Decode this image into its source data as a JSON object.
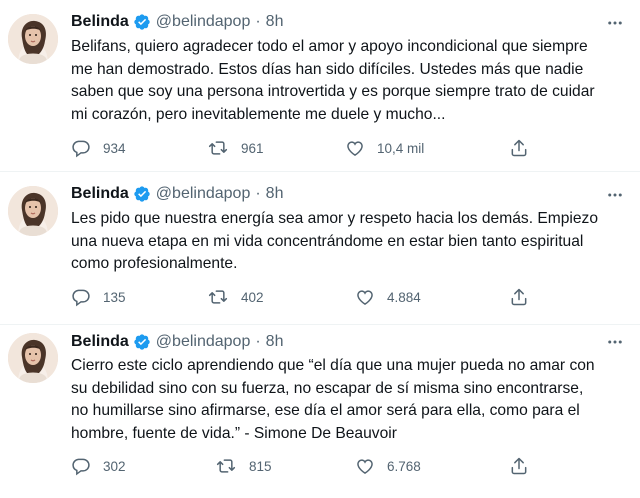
{
  "tweets": [
    {
      "author": "Belinda",
      "handle": "@belindapop",
      "separator": "·",
      "time": "8h",
      "text": "Belifans, quiero agradecer todo el amor y apoyo incondicional que siempre\nme han demostrado. Estos días han sido difíciles. Ustedes más que nadie\nsaben que soy una persona introvertida y es porque siempre trato de cuidar\nmi corazón, pero inevitablemente me duele y mucho...",
      "replies": "934",
      "retweets": "961",
      "likes": "10,4 mil"
    },
    {
      "author": "Belinda",
      "handle": "@belindapop",
      "separator": "·",
      "time": "8h",
      "text": "Les pido que nuestra energía sea amor y respeto hacia los demás. Empiezo\nuna nueva etapa en mi vida concentrándome en estar bien tanto espiritual\ncomo profesionalmente.",
      "replies": "135",
      "retweets": "402",
      "likes": "4.884"
    },
    {
      "author": "Belinda",
      "handle": "@belindapop",
      "separator": "·",
      "time": "8h",
      "text": "Cierro este ciclo aprendiendo que “el día que una mujer pueda no amar con\nsu debilidad sino con su fuerza, no escapar de sí misma sino encontrarse,\nno humillarse sino afirmarse, ese día el amor será para ella, como para el\nhombre, fuente de vida.” - Simone De Beauvoir",
      "replies": "302",
      "retweets": "815",
      "likes": "6.768"
    }
  ],
  "icons": {
    "verified": "verified-badge-icon",
    "more": "more-horizontal-icon",
    "reply": "reply-icon",
    "retweet": "retweet-icon",
    "like": "heart-icon",
    "share": "share-icon"
  },
  "colors": {
    "text": "#0f1419",
    "secondary": "#536471",
    "verified": "#1d9bf0",
    "divider": "#eff3f4"
  }
}
